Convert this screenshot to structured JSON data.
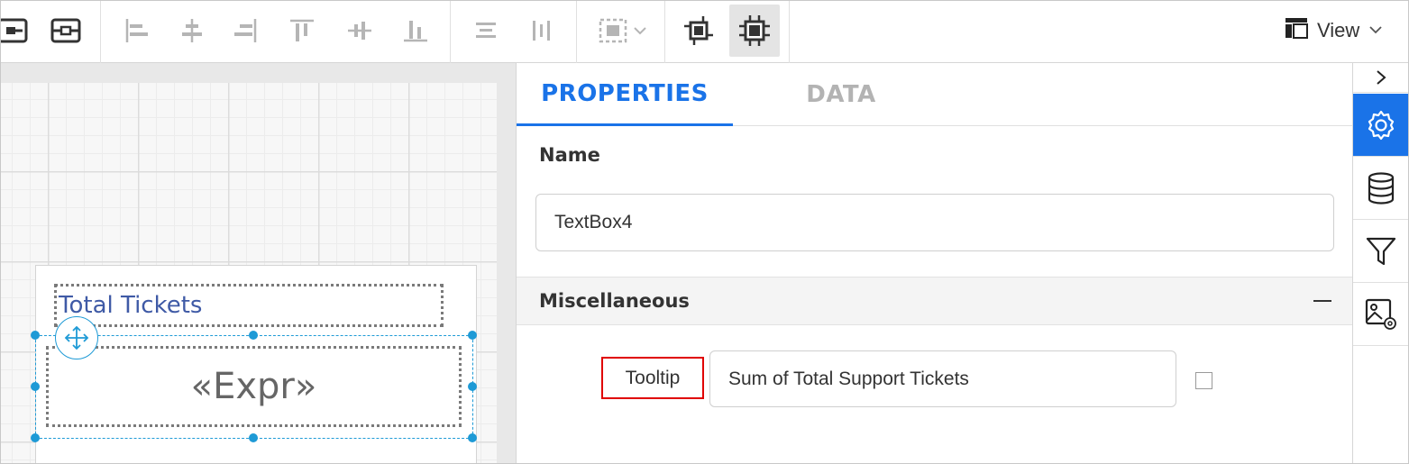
{
  "toolbar": {
    "view_label": "View",
    "tools": [
      "pagebreak-before-icon",
      "pagebreak-after-icon",
      "align-left-icon",
      "align-center-icon",
      "align-right-icon",
      "align-top-icon",
      "align-middle-icon",
      "align-bottom-icon",
      "distribute-horizontal-icon",
      "distribute-vertical-icon",
      "size-dropdown-icon",
      "center-horizontal-icon",
      "center-both-icon"
    ]
  },
  "canvas": {
    "title_text": "Total Tickets",
    "expression_text": "«Expr»"
  },
  "panel": {
    "tabs": [
      "PROPERTIES",
      "DATA"
    ],
    "active_tab": "PROPERTIES",
    "name_label": "Name",
    "name_value": "TextBox4",
    "section_title": "Miscellaneous",
    "tooltip_label": "Tooltip",
    "tooltip_value": "Sum of Total Support Tickets",
    "tooltip_checkbox_checked": false
  },
  "rail": {
    "items": [
      "collapse-chevron-icon",
      "settings-gear-icon",
      "database-icon",
      "filter-icon",
      "image-settings-icon"
    ],
    "active": "settings-gear-icon"
  },
  "colors": {
    "accent": "#1a73e8",
    "selection": "#1e9ad6",
    "highlight_border": "#e00000",
    "title_text": "#3f5aa6"
  }
}
